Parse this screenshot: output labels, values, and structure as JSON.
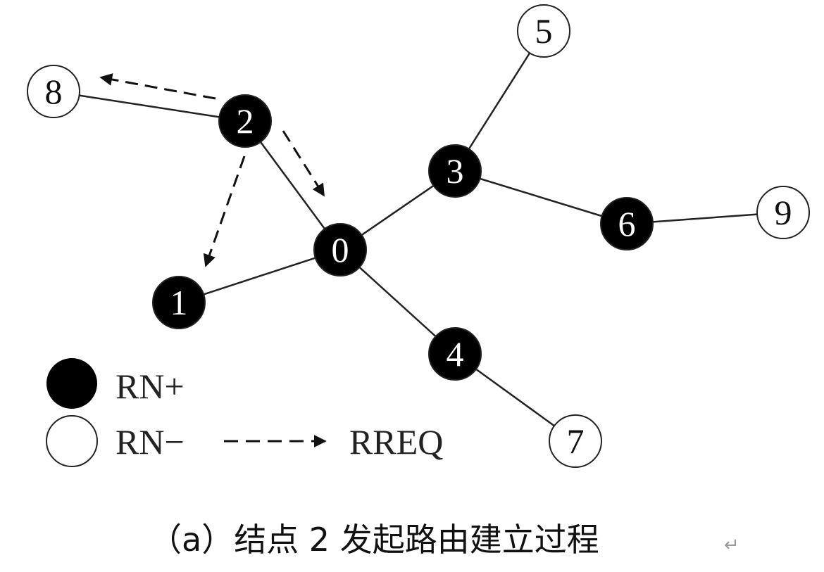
{
  "diagram": {
    "nodes": [
      {
        "id": "0",
        "label": "0",
        "type": "RN+"
      },
      {
        "id": "1",
        "label": "1",
        "type": "RN+"
      },
      {
        "id": "2",
        "label": "2",
        "type": "RN+"
      },
      {
        "id": "3",
        "label": "3",
        "type": "RN+"
      },
      {
        "id": "4",
        "label": "4",
        "type": "RN+"
      },
      {
        "id": "5",
        "label": "5",
        "type": "RN-"
      },
      {
        "id": "6",
        "label": "6",
        "type": "RN+"
      },
      {
        "id": "7",
        "label": "7",
        "type": "RN-"
      },
      {
        "id": "8",
        "label": "8",
        "type": "RN-"
      },
      {
        "id": "9",
        "label": "9",
        "type": "RN-"
      }
    ],
    "edges": [
      {
        "from": "8",
        "to": "2"
      },
      {
        "from": "2",
        "to": "0"
      },
      {
        "from": "1",
        "to": "0"
      },
      {
        "from": "0",
        "to": "3"
      },
      {
        "from": "3",
        "to": "5"
      },
      {
        "from": "3",
        "to": "6"
      },
      {
        "from": "6",
        "to": "9"
      },
      {
        "from": "0",
        "to": "4"
      },
      {
        "from": "4",
        "to": "7"
      }
    ],
    "messages": [
      {
        "from": "2",
        "to": "8",
        "type": "RREQ"
      },
      {
        "from": "2",
        "to": "0",
        "type": "RREQ"
      },
      {
        "from": "2",
        "to": "1",
        "type": "RREQ"
      }
    ],
    "legend": {
      "filled_label": "RN+",
      "empty_label": "RN−",
      "arrow_label": "RREQ"
    },
    "caption": "（a）结点 2 发起路由建立过程",
    "return_mark": "↵",
    "colors": {
      "filled": "#000000",
      "filled_text": "#ffffff",
      "empty": "#ffffff",
      "stroke": "#222222",
      "empty_text": "#111111"
    }
  }
}
